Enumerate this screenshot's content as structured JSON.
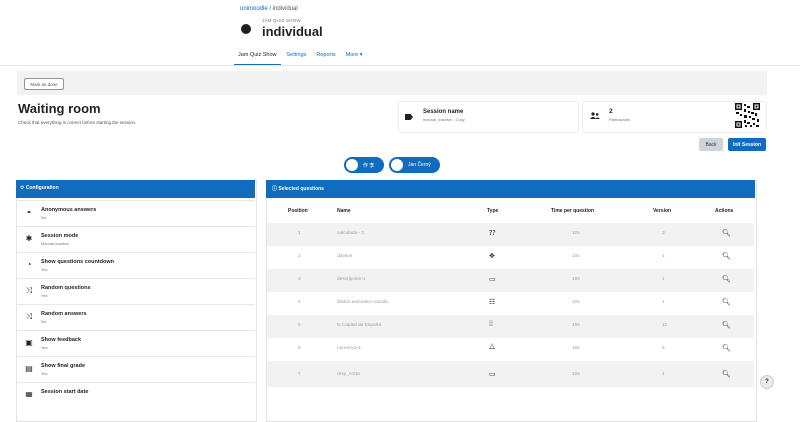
{
  "breadcrumb": {
    "course": "unimoodle",
    "sep": "/",
    "current": "individual"
  },
  "page": {
    "subtitle": "JAM QUIZ SHOW",
    "title": "individual"
  },
  "tabs": [
    {
      "label": "Jam Quiz Show",
      "active": true
    },
    {
      "label": "Settings",
      "active": false
    },
    {
      "label": "Reports",
      "active": false
    },
    {
      "label": "More ▾",
      "active": false
    }
  ],
  "mark_done": "Mark as done",
  "waiting": {
    "title": "Waiting room",
    "subtitle": "Check that everything is correct before starting the session."
  },
  "session": {
    "label": "Session name",
    "value": "manual_inactive - Copy"
  },
  "participants": {
    "count": "2",
    "label": "Participants"
  },
  "buttons": {
    "back": "Back",
    "init": "Init Session"
  },
  "users": [
    "作 李",
    "Jan Černý"
  ],
  "config": {
    "title": "Configuration",
    "items": [
      {
        "name": "Anonymous answers",
        "value": "No",
        "icon": "mask-icon",
        "glyph": "◓"
      },
      {
        "name": "Session mode",
        "value": "Manual inactive",
        "icon": "puzzle-icon",
        "glyph": "✱"
      },
      {
        "name": "Show questions countdown",
        "value": "Yes",
        "icon": "stopwatch-icon",
        "glyph": "◔"
      },
      {
        "name": "Random questions",
        "value": "Yes",
        "icon": "shuffle-icon",
        "glyph": "⤨"
      },
      {
        "name": "Random answers",
        "value": "No",
        "icon": "shuffle-icon",
        "glyph": "⤨"
      },
      {
        "name": "Show feedback",
        "value": "Yes",
        "icon": "feedback-icon",
        "glyph": "▣"
      },
      {
        "name": "Show final grade",
        "value": "Yes",
        "icon": "grade-icon",
        "glyph": "▤"
      },
      {
        "name": "Session start date",
        "value": "",
        "icon": "calendar-icon",
        "glyph": "▦"
      }
    ]
  },
  "questions": {
    "title": "Selected questions",
    "headers": {
      "position": "Position",
      "name": "Name",
      "type": "Type",
      "time": "Time per question",
      "version": "Version",
      "actions": "Actions"
    },
    "rows": [
      {
        "position": "1",
        "name": "calculada - 1",
        "type_icon": "calculated-icon",
        "type_glyph": "⁇",
        "time": "10s",
        "version": "3"
      },
      {
        "position": "2",
        "name": "ddwtos",
        "type_icon": "drag-drop-icon",
        "type_glyph": "✥",
        "time": "10s",
        "version": "1"
      },
      {
        "position": "3",
        "name": "descripcion-1",
        "type_icon": "description-icon",
        "type_glyph": "▭",
        "time": "10s",
        "version": "1"
      },
      {
        "position": "4",
        "name": "Match-animales-comida",
        "type_icon": "matching-icon",
        "type_glyph": "☷",
        "time": "10s",
        "version": "1"
      },
      {
        "position": "5",
        "name": "N.Capital de España",
        "type_icon": "numerical-icon",
        "type_glyph": "⁞⁞",
        "time": "10s",
        "version": "12"
      },
      {
        "position": "6",
        "name": "numerica-1",
        "type_icon": "calculator-icon",
        "type_glyph": "⧊",
        "time": "10s",
        "version": "6"
      },
      {
        "position": "7",
        "name": "resp_corta",
        "type_icon": "short-answer-icon",
        "type_glyph": "▭",
        "time": "10s",
        "version": "1"
      }
    ]
  },
  "help": "?"
}
